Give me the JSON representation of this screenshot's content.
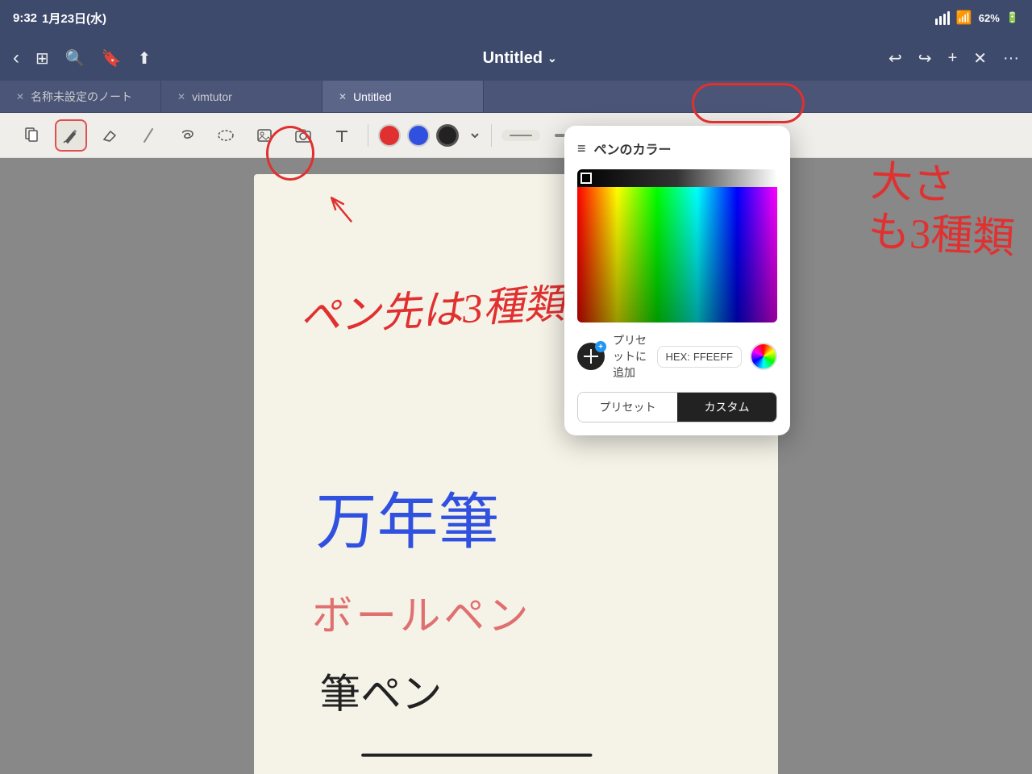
{
  "statusBar": {
    "time": "9:32",
    "day": "1月23日(水)",
    "signal": "●●●",
    "wifi": "wifi",
    "battery": "62%"
  },
  "navBar": {
    "title": "Untitled",
    "chevron": "›",
    "backLabel": "‹",
    "undoLabel": "↩",
    "redoLabel": "↪",
    "addLabel": "+",
    "closeLabel": "✕",
    "moreLabel": "···"
  },
  "tabs": [
    {
      "id": "tab1",
      "label": "名称未設定のノート",
      "active": false
    },
    {
      "id": "tab2",
      "label": "vimtutor",
      "active": false
    },
    {
      "id": "tab3",
      "label": "Untitled",
      "active": true
    }
  ],
  "toolbar": {
    "tools": [
      {
        "id": "page-tool",
        "icon": "⊞",
        "label": "page"
      },
      {
        "id": "pen-tool",
        "icon": "✏",
        "label": "pen",
        "active": true
      },
      {
        "id": "eraser-tool",
        "icon": "◇",
        "label": "eraser"
      },
      {
        "id": "pencil-tool",
        "icon": "∕",
        "label": "pencil"
      },
      {
        "id": "lasso-tool",
        "icon": "⌒",
        "label": "lasso"
      },
      {
        "id": "select-tool",
        "icon": "⬭",
        "label": "select"
      },
      {
        "id": "image-tool",
        "icon": "⊡",
        "label": "image"
      },
      {
        "id": "camera-tool",
        "icon": "◎",
        "label": "camera"
      },
      {
        "id": "text-tool",
        "icon": "T",
        "label": "text"
      }
    ],
    "colors": [
      {
        "id": "red",
        "hex": "#e03030",
        "selected": false
      },
      {
        "id": "blue",
        "hex": "#3050e0",
        "selected": false
      },
      {
        "id": "black",
        "hex": "#222222",
        "selected": true
      }
    ],
    "sizes": [
      "sm",
      "md",
      "lg"
    ]
  },
  "colorPicker": {
    "title": "ペンのカラー",
    "filterIcon": "☰",
    "addPresetLabel": "プリセットに追加",
    "hexLabel": "HEX:",
    "hexValue": "FFEEFF",
    "presetTabLabel": "プリセット",
    "customTabLabel": "カスタム",
    "activeTab": "custom"
  }
}
